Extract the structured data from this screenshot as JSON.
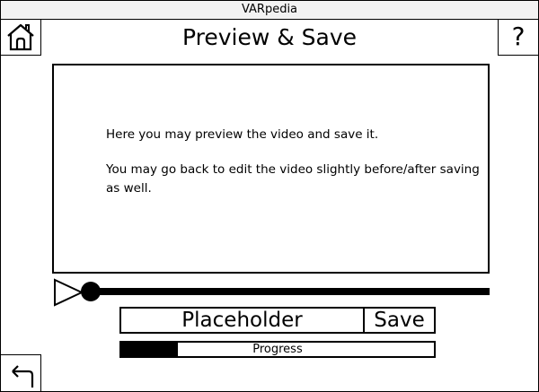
{
  "window": {
    "title": "VARpedia"
  },
  "header": {
    "title": "Preview & Save",
    "help_label": "?"
  },
  "icons": {
    "home": "home-icon",
    "back": "back-arrow-icon",
    "play": "play-icon"
  },
  "preview": {
    "line1": "Here you may preview the video and save it.",
    "line2": "You may go back to edit the video slightly before/after saving as well."
  },
  "player": {
    "position_fraction": 0.0
  },
  "save_form": {
    "name_value": "Placeholder",
    "save_label": "Save"
  },
  "progress": {
    "label": "Progress",
    "fraction": 0.18
  }
}
